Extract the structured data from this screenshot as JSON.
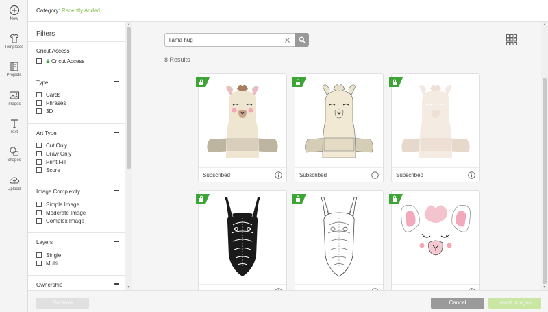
{
  "rail": {
    "items": [
      {
        "label": "New",
        "icon": "plus-circle-icon"
      },
      {
        "label": "Templates",
        "icon": "shirt-icon"
      },
      {
        "label": "Projects",
        "icon": "projects-icon"
      },
      {
        "label": "Images",
        "icon": "image-icon"
      },
      {
        "label": "Text",
        "icon": "text-icon"
      },
      {
        "label": "Shapes",
        "icon": "shapes-icon"
      },
      {
        "label": "Upload",
        "icon": "upload-cloud-icon"
      }
    ]
  },
  "header": {
    "category_label": "Category:",
    "category_value": "Recently Added"
  },
  "filters": {
    "title": "Filters",
    "sections": [
      {
        "title": "Cricut Access",
        "collapsible": false,
        "options": [
          "Cricut Access"
        ]
      },
      {
        "title": "Type",
        "options": [
          "Cards",
          "Phrases",
          "3D"
        ]
      },
      {
        "title": "Art Type",
        "options": [
          "Cut Only",
          "Draw Only",
          "Print Fill",
          "Score"
        ]
      },
      {
        "title": "Image Complexity",
        "options": [
          "Simple Image",
          "Moderate Image",
          "Complex Image"
        ]
      },
      {
        "title": "Layers",
        "options": [
          "Single",
          "Multi"
        ]
      },
      {
        "title": "Ownership",
        "options": []
      }
    ]
  },
  "search": {
    "value": "llama hug",
    "placeholder": ""
  },
  "results_count": "8 Results",
  "cards": [
    {
      "status": "Subscribed",
      "art": "llama-hug-color"
    },
    {
      "status": "Subscribed",
      "art": "llama-hug-cream"
    },
    {
      "status": "Subscribed",
      "art": "llama-hug-faded"
    },
    {
      "status": "",
      "art": "llama-mandala-black"
    },
    {
      "status": "",
      "art": "llama-mandala-outline"
    },
    {
      "status": "",
      "art": "llama-face-pink"
    }
  ],
  "footer": {
    "remove_label": "Remove",
    "cancel_label": "Cancel",
    "insert_label": "Insert Images"
  },
  "colors": {
    "accent_green": "#7fb83d",
    "badge_green": "#3da535",
    "cancel_gray": "#9a9a9a",
    "insert_disabled": "#c9e6a3"
  }
}
